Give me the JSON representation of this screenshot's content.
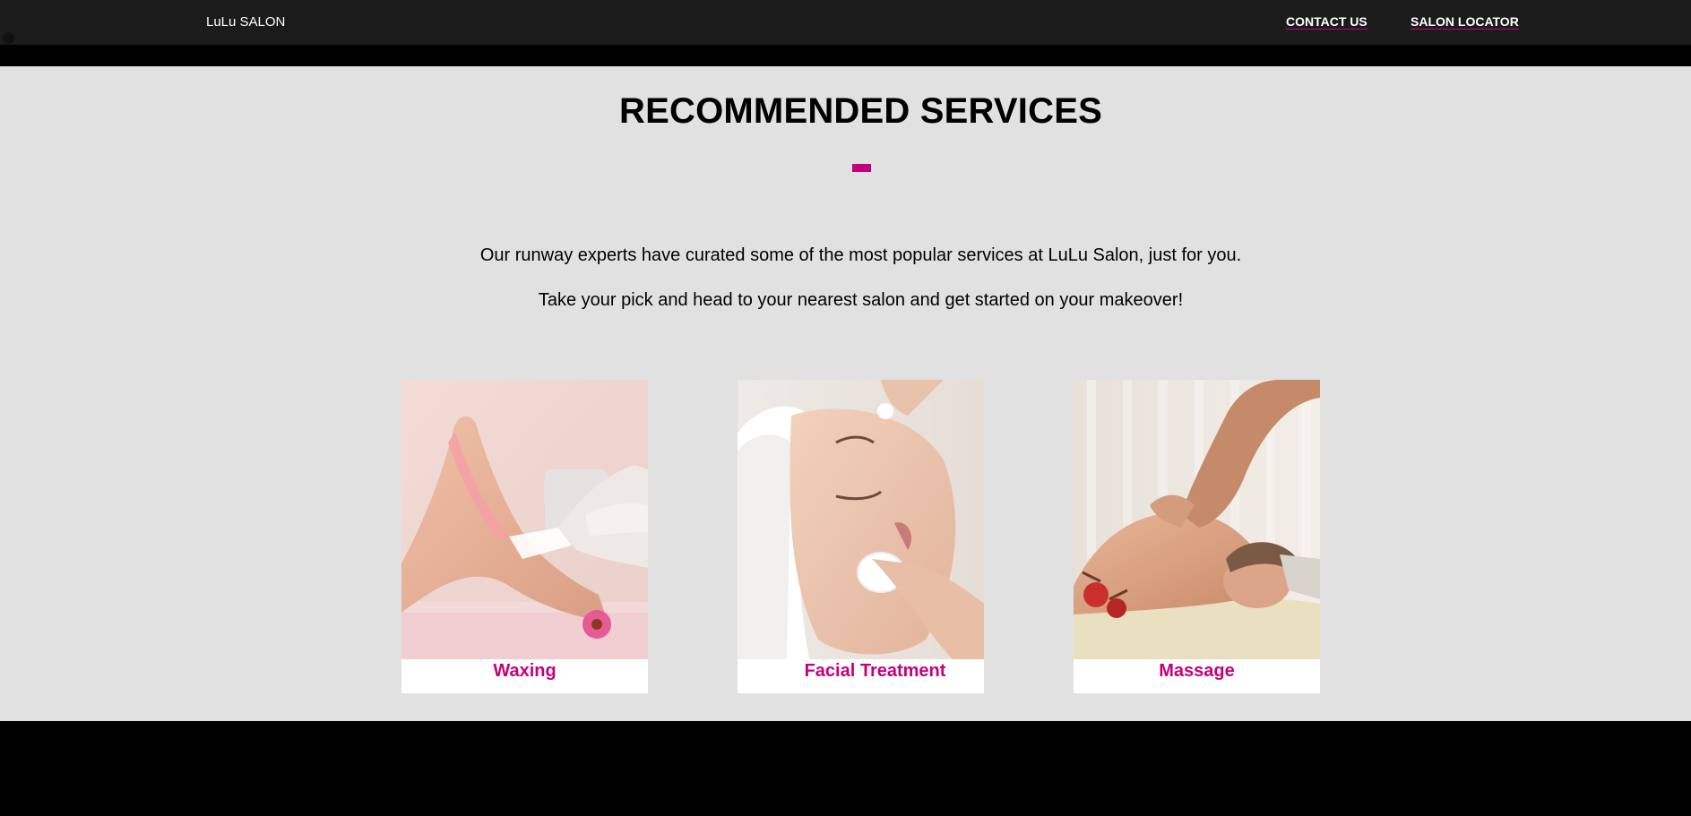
{
  "navbar": {
    "brand": "LuLu SALON",
    "links": [
      {
        "label": "CONTACT US"
      },
      {
        "label": "SALON LOCATOR"
      }
    ]
  },
  "main": {
    "title": "RECOMMENDED SERVICES",
    "intro_lines": [
      "Our runway experts have curated some of the most popular services at LuLu Salon, just for you.",
      "Take your pick and head to your nearest salon and get started on your makeover!"
    ],
    "services": [
      {
        "label": "Waxing",
        "image": "waxing-photo"
      },
      {
        "label": "Facial Treatment",
        "image": "facial-photo"
      },
      {
        "label": "Massage",
        "image": "massage-photo"
      }
    ]
  },
  "colors": {
    "accent": "#c4007f",
    "navbar_bg": "#1b1b1b",
    "section_bg": "#e1e1e1",
    "page_bg": "#000000"
  }
}
